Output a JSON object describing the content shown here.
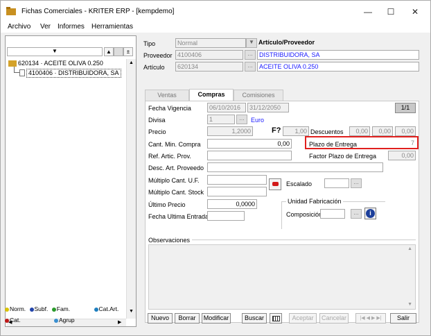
{
  "window": {
    "title": "Fichas Comerciales - KRITER ERP - [kempdemo]",
    "minimize": "—",
    "maximize": "☐",
    "close": "✕"
  },
  "menu": [
    "Archivo",
    "Ver",
    "Informes",
    "Herramientas"
  ],
  "tree": {
    "root": "620134 · ACEITE OLIVA 0.250",
    "child": "4100406 · DISTRIBUIDORA, SA"
  },
  "legend": {
    "norm": "Norm.",
    "subf": "Subf.",
    "fam": "Fam.",
    "catart": "Cat.Art.",
    "cat": "Cat.",
    "agrup": "Agrup",
    "colors": {
      "norm": "#d9c200",
      "subf": "#2244aa",
      "fam": "#2a9a2a",
      "catart": "#1e7fbf",
      "cat": "#c01818",
      "agrup": "#3a8fd0"
    }
  },
  "header": {
    "tipo_label": "Tipo",
    "tipo_value": "Normal",
    "tipo_desc": "Artículo/Proveedor",
    "proveedor_label": "Proveedor",
    "proveedor_value": "4100406",
    "proveedor_desc": "DISTRIBUIDORA, SA",
    "articulo_label": "Artículo",
    "articulo_value": "620134",
    "articulo_desc": "ACEITE OLIVA 0.250"
  },
  "tabs": [
    "Ventas",
    "Compras",
    "Comisiones"
  ],
  "compras": {
    "fecha_vigencia_label": "Fecha Vigencia",
    "fecha_desde": "06/10/2016",
    "fecha_hasta": "31/12/2050",
    "page": "1/1",
    "divisa_label": "Divisa",
    "divisa_value": "1",
    "divisa_desc": "Euro",
    "precio_label": "Precio",
    "precio_value": "1,2000",
    "f_label": "F?",
    "f_value": "1,00",
    "descuentos_label": "Descuentos",
    "desc1": "0,00",
    "desc2": "0,00",
    "desc3": "0,00",
    "cant_min_label": "Cant. Min. Compra",
    "cant_min_value": "0,00",
    "plazo_label": "Plazo de Entrega",
    "plazo_value": "7",
    "ref_label": "Ref. Artic. Prov.",
    "factor_label": "Factor Plazo de Entrega",
    "factor_value": "0,00",
    "desc_art_label": "Desc. Art. Proveedo",
    "mult_uf_label": "Múltiplo Cant. U.F.",
    "mult_stock_label": "Múltiplo Cant. Stock",
    "escalado_label": "Escalado",
    "ultimo_precio_label": "Último Precio",
    "ultimo_precio_value": "0,0000",
    "unidad_fab_label": "Unidad Fabricación",
    "composicion_label": "Composición",
    "fecha_ult_label": "Fecha Ultima Entrada",
    "observaciones_label": "Observaciones"
  },
  "buttons": {
    "nuevo": "Nuevo",
    "borrar": "Borrar",
    "modificar": "Modificar",
    "buscar": "Buscar",
    "aceptar": "Aceptar",
    "cancelar": "Cancelar",
    "salir": "Salir"
  }
}
